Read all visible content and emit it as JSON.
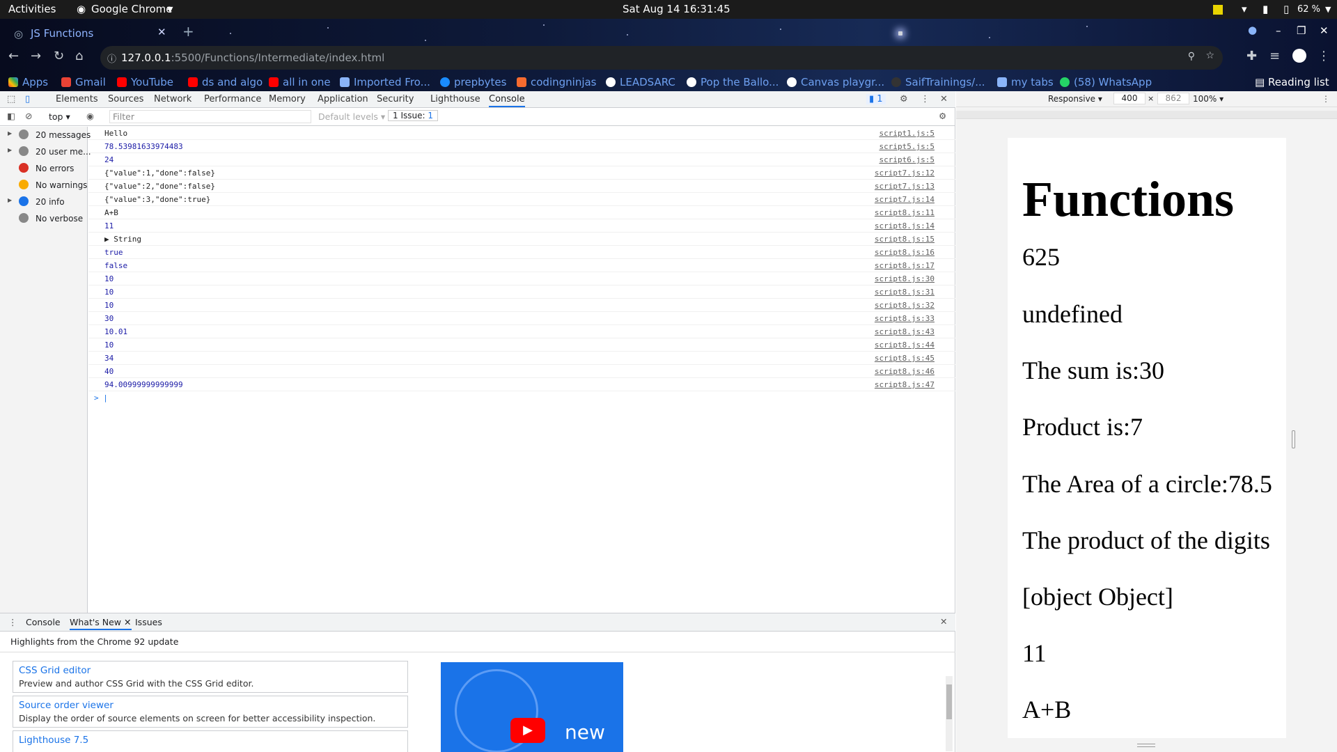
{
  "topbar": {
    "activities": "Activities",
    "app": "Google Chrome",
    "datetime": "Sat Aug 14  16:31:45",
    "battery": "62 %"
  },
  "tab": {
    "title": "JS Functions"
  },
  "omnibox": {
    "host": "127.0.0.1",
    "path": ":5500/Functions/Intermediate/index.html"
  },
  "bookmarks": [
    "Apps",
    "Gmail",
    "YouTube",
    "ds and algo",
    "all in one",
    "Imported Fro...",
    "prepbytes",
    "codingninjas",
    "LEADSARC",
    "Pop the Ballo...",
    "Canvas playgr...",
    "SaifTrainings/...",
    "my tabs",
    "(58) WhatsApp"
  ],
  "reading_list": "Reading list",
  "devtools": {
    "tabs": [
      "Elements",
      "Sources",
      "Network",
      "Performance",
      "Memory",
      "Application",
      "Security",
      "Lighthouse",
      "Console"
    ],
    "issues_badge": "1",
    "context": "top",
    "filter_placeholder": "Filter",
    "levels": "Default levels",
    "issue_count": "1 Issue:",
    "issue_num": "1",
    "sidebar": [
      "20 messages",
      "20 user me...",
      "No errors",
      "No warnings",
      "20 info",
      "No verbose"
    ],
    "log": [
      {
        "msg": "Hello",
        "src": "script1.js:5"
      },
      {
        "msg": "78.53981633974483",
        "src": "script5.js:5"
      },
      {
        "msg": "24",
        "src": "script6.js:5"
      },
      {
        "msg": "{\"value\":1,\"done\":false}",
        "src": "script7.js:12"
      },
      {
        "msg": "{\"value\":2,\"done\":false}",
        "src": "script7.js:13"
      },
      {
        "msg": "{\"value\":3,\"done\":true}",
        "src": "script7.js:14"
      },
      {
        "msg": "A+B",
        "src": "script8.js:11"
      },
      {
        "msg": "11",
        "src": "script8.js:14"
      },
      {
        "msg": "▶ String",
        "src": "script8.js:15"
      },
      {
        "msg": "true",
        "src": "script8.js:16"
      },
      {
        "msg": "false",
        "src": "script8.js:17"
      },
      {
        "msg": "10",
        "src": "script8.js:30"
      },
      {
        "msg": "10",
        "src": "script8.js:31"
      },
      {
        "msg": "10",
        "src": "script8.js:32"
      },
      {
        "msg": "30",
        "src": "script8.js:33"
      },
      {
        "msg": "10.01",
        "src": "script8.js:43"
      },
      {
        "msg": "10",
        "src": "script8.js:44"
      },
      {
        "msg": "34",
        "src": "script8.js:45"
      },
      {
        "msg": "40",
        "src": "script8.js:46"
      },
      {
        "msg": "94.00999999999999",
        "src": "script8.js:47"
      }
    ],
    "drawer_tabs": [
      "Console",
      "What's New",
      "Issues"
    ],
    "drawer_heading": "Highlights from the Chrome 92 update",
    "cards": [
      {
        "title": "CSS Grid editor",
        "desc": "Preview and author CSS Grid with the CSS Grid editor."
      },
      {
        "title": "Source order viewer",
        "desc": "Display the order of source elements on screen for better accessibility inspection."
      },
      {
        "title": "Lighthouse 7.5",
        "desc": ""
      }
    ],
    "video_label": "new"
  },
  "device": {
    "mode": "Responsive",
    "width": "400",
    "height": "862",
    "zoom": "100%"
  },
  "viewport": {
    "heading": "Functions",
    "lines": [
      "625",
      "undefined",
      "The sum is:30",
      "Product is:7",
      "The Area of a circle:78.5",
      "The product of the digits",
      "[object Object]",
      "11",
      "A+B"
    ]
  }
}
